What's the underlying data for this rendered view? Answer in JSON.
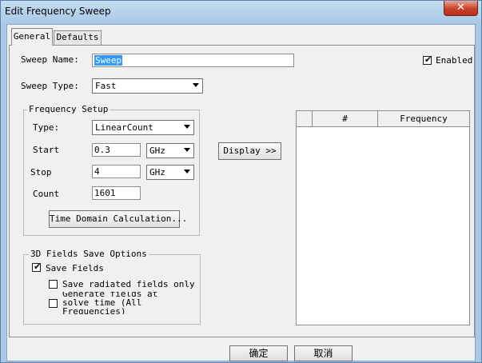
{
  "window": {
    "title": "Edit Frequency Sweep",
    "close_glyph": "✕"
  },
  "tabs": [
    {
      "label": "General"
    },
    {
      "label": "Defaults"
    }
  ],
  "general": {
    "sweep_name_label": "Sweep Name:",
    "sweep_name_value": "Sweep",
    "enabled_label": "Enabled",
    "enabled_checked": true,
    "sweep_type_label": "Sweep Type:",
    "sweep_type_value": "Fast"
  },
  "frequency_setup": {
    "title": "Frequency Setup",
    "type_label": "Type:",
    "type_value": "LinearCount",
    "start_label": "Start",
    "start_value": "0.3",
    "start_unit": "GHz",
    "stop_label": "Stop",
    "stop_value": "4",
    "stop_unit": "GHz",
    "count_label": "Count",
    "count_value": "1601",
    "time_domain_button": "Time Domain Calculation..."
  },
  "display_button": "Display >>",
  "grid": {
    "columns": [
      "#",
      "Frequency"
    ]
  },
  "fields_save": {
    "title": "3D Fields Save Options",
    "save_fields_label": "Save Fields",
    "save_fields_checked": true,
    "save_radiated_label": "Save radiated fields only",
    "save_radiated_checked": false,
    "generate_fields_line1": "Generate fields at",
    "generate_fields_line2": "solve time (All",
    "generate_fields_line3": "Frequencies)",
    "generate_fields_checked": false
  },
  "buttons": {
    "ok": "确定",
    "cancel": "取消"
  },
  "icons": {
    "checkmark": "check-icon",
    "dropdown": "chevron-down-icon",
    "close": "close-icon"
  },
  "colors": {
    "selection": "#3399ff",
    "close_button": "#c7432b",
    "frame": "#a8c8e6"
  }
}
